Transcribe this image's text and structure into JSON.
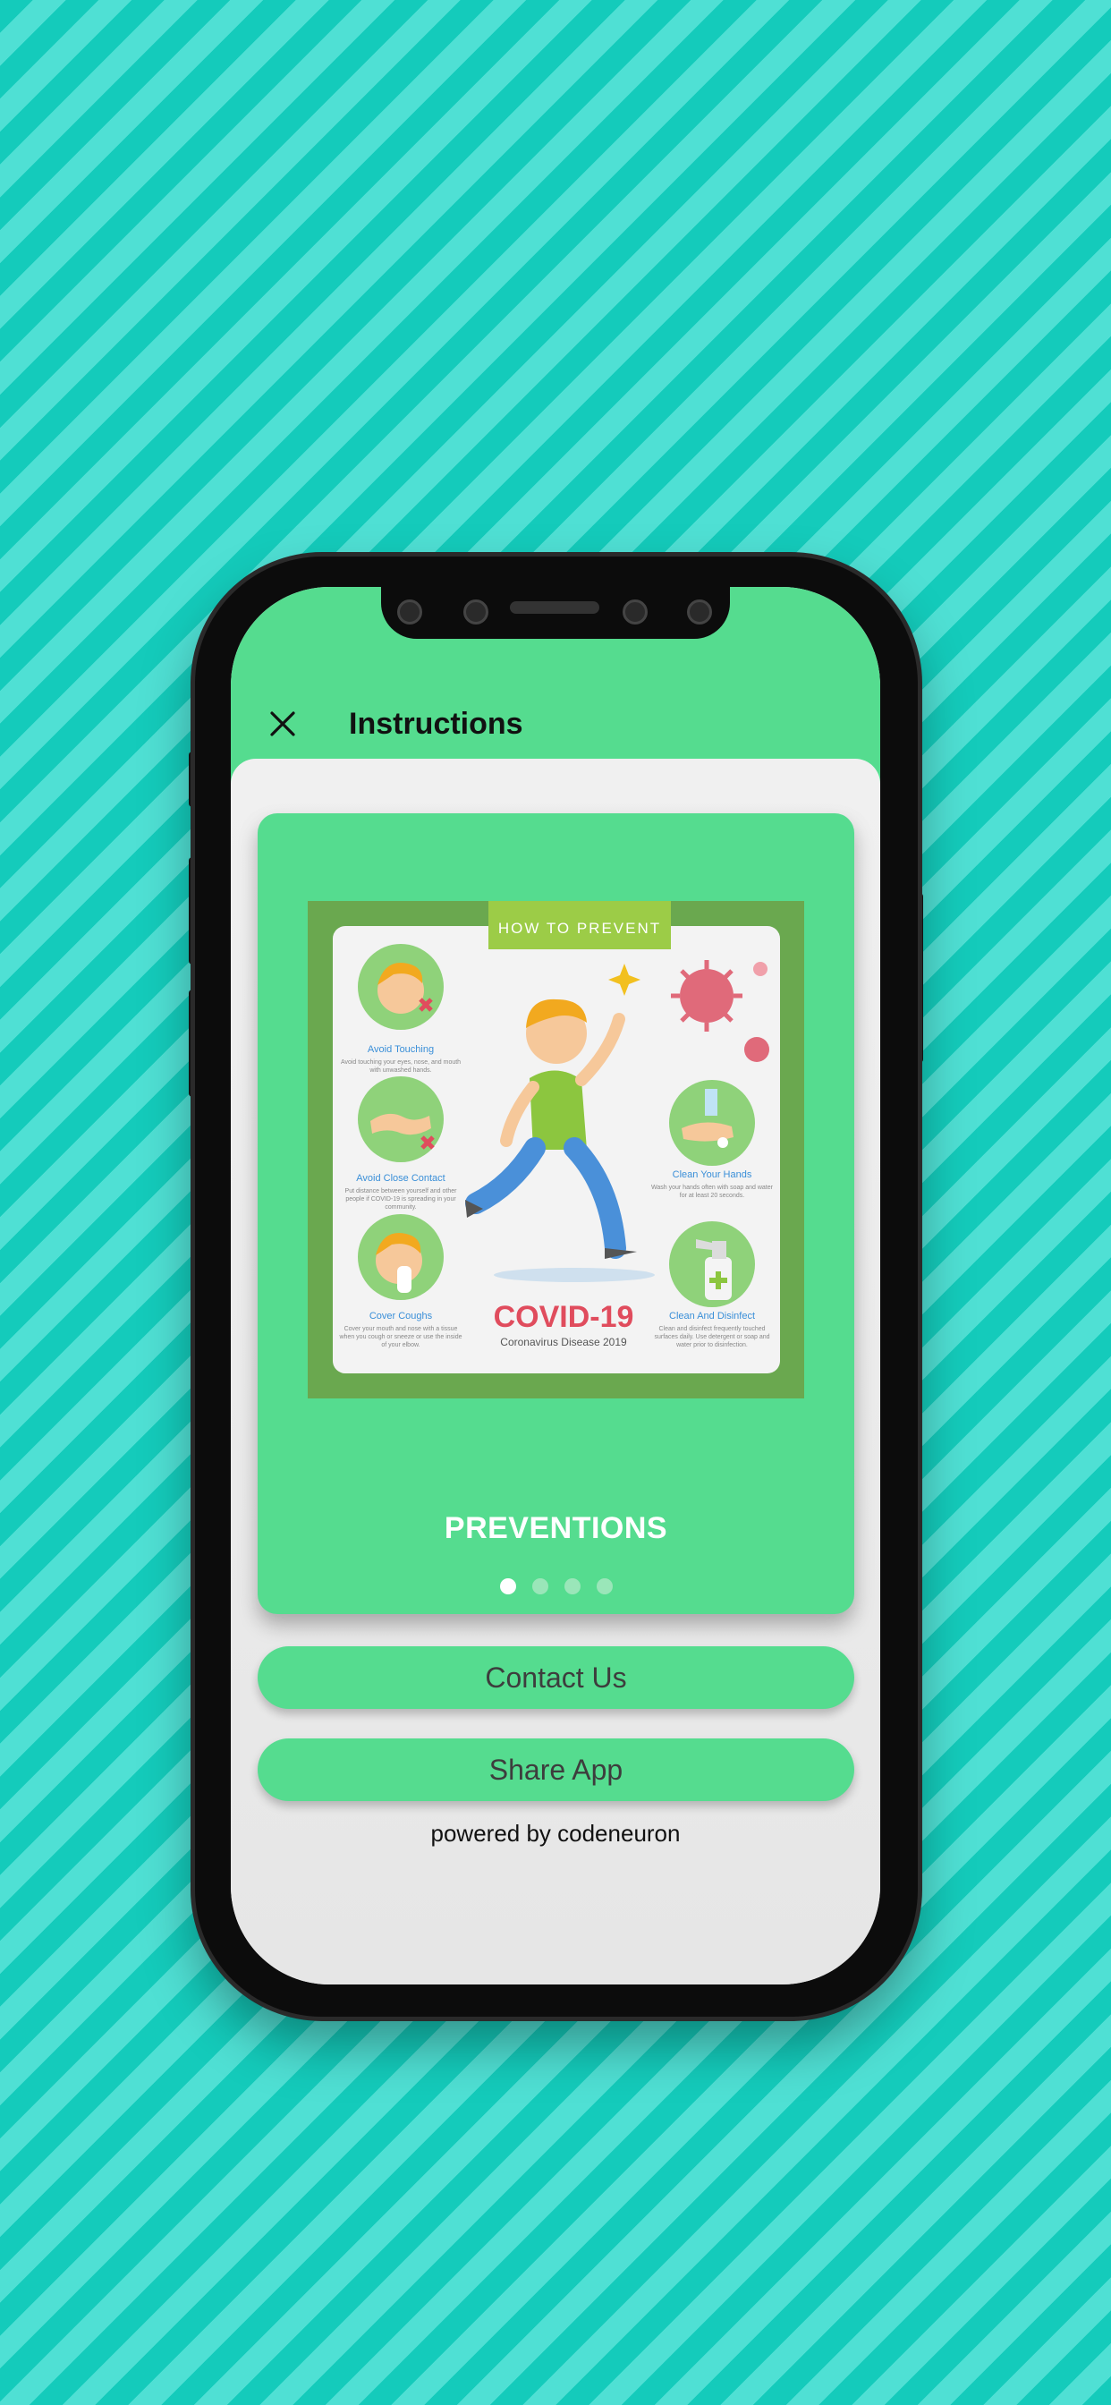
{
  "header": {
    "title": "Instructions"
  },
  "card": {
    "title": "PREVENTIONS",
    "pagination": {
      "count": 4,
      "active_index": 0
    },
    "poster": {
      "tag": "HOW TO PREVENT",
      "headline": "COVID-19",
      "subheadline": "Coronavirus Disease 2019",
      "tips": [
        {
          "label": "Avoid Touching",
          "desc": "Avoid touching your eyes, nose, and mouth with unwashed hands."
        },
        {
          "label": "Avoid Close Contact",
          "desc": "Put distance between yourself and other people if COVID-19 is spreading in your community."
        },
        {
          "label": "Cover Coughs",
          "desc": "Cover your mouth and nose with a tissue when you cough or sneeze or use the inside of your elbow."
        },
        {
          "label": "Clean Your Hands",
          "desc": "Wash your hands often with soap and water for at least 20 seconds."
        },
        {
          "label": "Clean And Disinfect",
          "desc": "Clean and disinfect frequently touched surfaces daily. Use detergent or soap and water prior to disinfection."
        }
      ]
    }
  },
  "buttons": {
    "contact": "Contact Us",
    "share": "Share App"
  },
  "footer": {
    "powered_by": "powered by codeneuron"
  },
  "colors": {
    "accent": "#55dc8f",
    "covid_red": "#e04c5d",
    "tip_blue": "#3a8fd8"
  }
}
